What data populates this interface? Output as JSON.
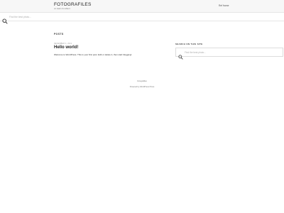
{
  "header": {
    "site_title": "FOTOGRAFILES",
    "tagline": "on learn & reflect",
    "nav_link": "Ref frame"
  },
  "top_search": {
    "placeholder": "Find the best photo..."
  },
  "main": {
    "posts_label": "POSTS",
    "post": {
      "meta": "december 4, 2021",
      "title": "Hello world!",
      "excerpt": "Welcome to WordPress. This is your first post. Edit or delete it, then start blogging!"
    }
  },
  "sidebar": {
    "widget_title": "SEARCH ON THIS SITE",
    "search_placeholder": "Find the best photo..."
  },
  "footer": {
    "site_name": "Fotografiles",
    "powered_by": "Powered by WordPress Press"
  },
  "icons": {
    "top_search": "search-icon",
    "sidebar_search": "search-icon"
  }
}
